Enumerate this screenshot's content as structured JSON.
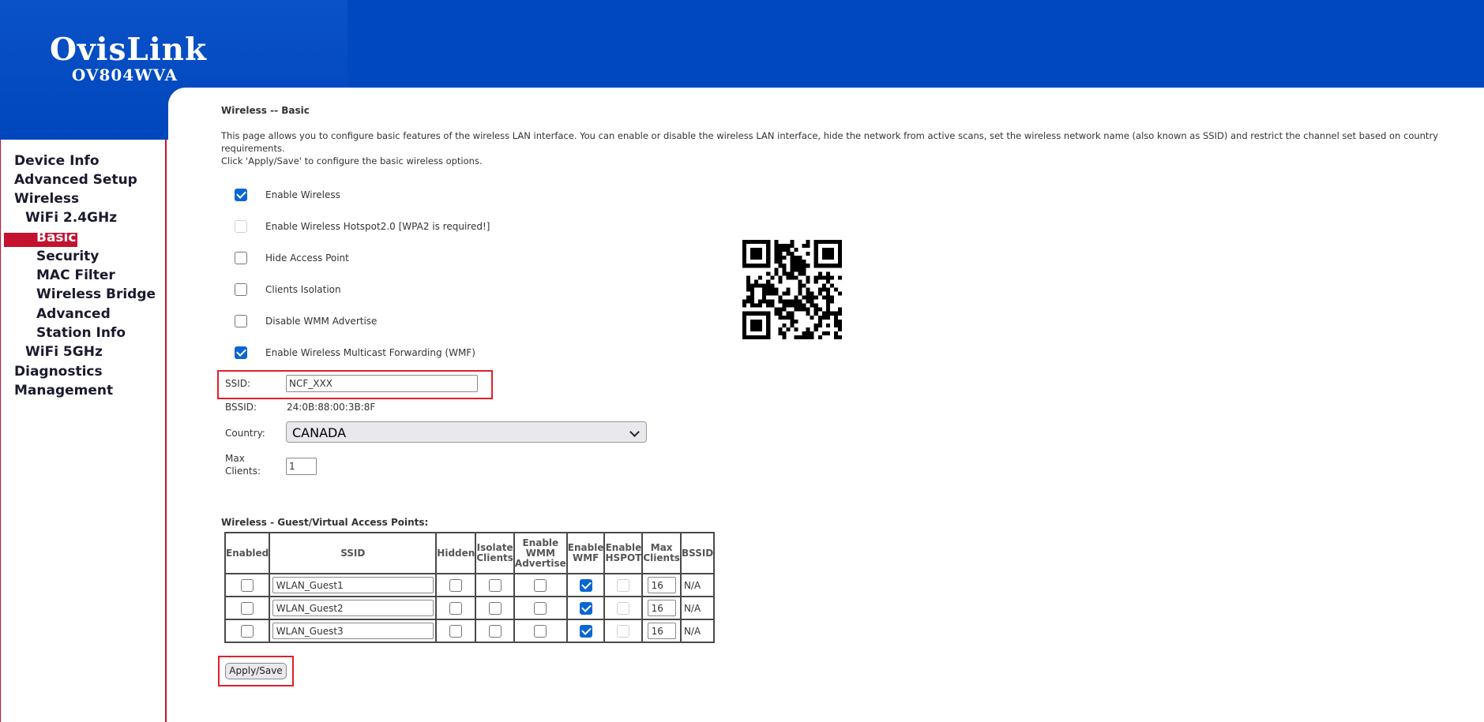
{
  "brand": {
    "name": "OvisLink",
    "model": "OV804WVA"
  },
  "colors": {
    "header_blue": "#0048c0",
    "nav_red": "#c41230",
    "highlight_red": "#e0202a",
    "check_blue": "#0a66d4"
  },
  "nav": {
    "device_info": "Device Info",
    "advanced_setup": "Advanced Setup",
    "wireless": "Wireless",
    "wifi_24": "WiFi 2.4GHz",
    "basic": "Basic",
    "security": "Security",
    "mac_filter": "MAC Filter",
    "wireless_bridge": "Wireless Bridge",
    "advanced": "Advanced",
    "station_info": "Station Info",
    "wifi_5": "WiFi 5GHz",
    "diagnostics": "Diagnostics",
    "management": "Management"
  },
  "page": {
    "title": "Wireless -- Basic",
    "desc_line1": "This page allows you to configure basic features of the wireless LAN interface. You can enable or disable the wireless LAN interface, hide the network from active scans, set the wireless network name (also known as SSID) and restrict the channel set based on country",
    "desc_line2": "requirements.",
    "desc_line3": "Click 'Apply/Save' to configure the basic wireless options."
  },
  "options": {
    "enable_wireless": "Enable Wireless",
    "hotspot": "Enable Wireless Hotspot2.0 [WPA2 is required!]",
    "hide_ap": "Hide Access Point",
    "clients_isolation": "Clients Isolation",
    "disable_wmm": "Disable WMM Advertise",
    "enable_wmf": "Enable Wireless Multicast Forwarding (WMF)"
  },
  "fields": {
    "ssid_label": "SSID:",
    "ssid_value": "NCF_XXX",
    "bssid_label": "BSSID:",
    "bssid_value": "24:0B:88:00:3B:8F",
    "country_label": "Country:",
    "country_value": "CANADA",
    "max_clients_label1": "Max",
    "max_clients_label2": "Clients:",
    "max_clients_value": "1"
  },
  "vap": {
    "title": "Wireless - Guest/Virtual Access Points:",
    "headers": {
      "enabled": "Enabled",
      "ssid": "SSID",
      "hidden": "Hidden",
      "isolate_1": "Isolate",
      "isolate_2": "Clients",
      "wmm_1": "Enable",
      "wmm_2": "WMM",
      "wmm_3": "Advertise",
      "wmf_1": "Enable",
      "wmf_2": "WMF",
      "hspot_1": "Enable",
      "hspot_2": "HSPOT",
      "max_1": "Max",
      "max_2": "Clients",
      "bssid": "BSSID"
    },
    "rows": [
      {
        "ssid": "WLAN_Guest1",
        "max": "16",
        "bssid": "N/A"
      },
      {
        "ssid": "WLAN_Guest2",
        "max": "16",
        "bssid": "N/A"
      },
      {
        "ssid": "WLAN_Guest3",
        "max": "16",
        "bssid": "N/A"
      }
    ]
  },
  "apply_label": "Apply/Save"
}
